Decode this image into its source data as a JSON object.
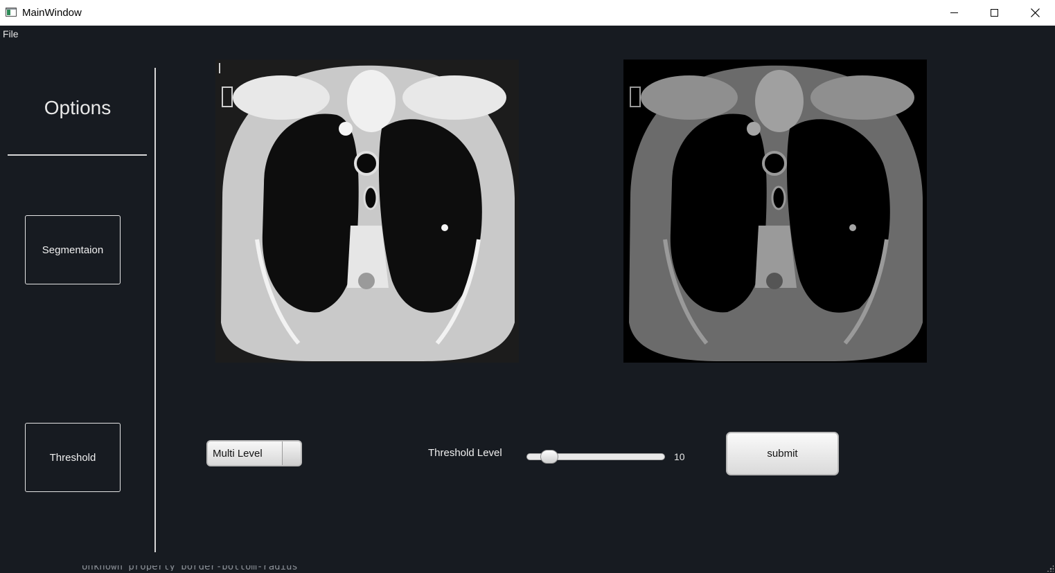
{
  "window": {
    "title": "MainWindow",
    "controls": [
      "minimize",
      "maximize",
      "close"
    ]
  },
  "menu": {
    "items": [
      {
        "label": "File"
      }
    ]
  },
  "sidebar": {
    "title": "Options",
    "buttons": [
      {
        "label": "Segmentaion"
      },
      {
        "label": "Threshold"
      }
    ]
  },
  "images": {
    "original": {
      "description": "CT chest scan, grayscale"
    },
    "segmented": {
      "description": "Segmented CT chest scan, multi-level"
    }
  },
  "controls": {
    "mode_select": {
      "value": "Multi Level"
    },
    "threshold": {
      "label": "Threshold Level",
      "value": "10",
      "min": 0,
      "max": 100
    },
    "submit_label": "submit"
  },
  "status": {
    "text": "Unknown property border-bottom-radius"
  },
  "colors": {
    "background": "#171b21",
    "titlebar": "#ffffff",
    "text": "#f0f0f0"
  }
}
